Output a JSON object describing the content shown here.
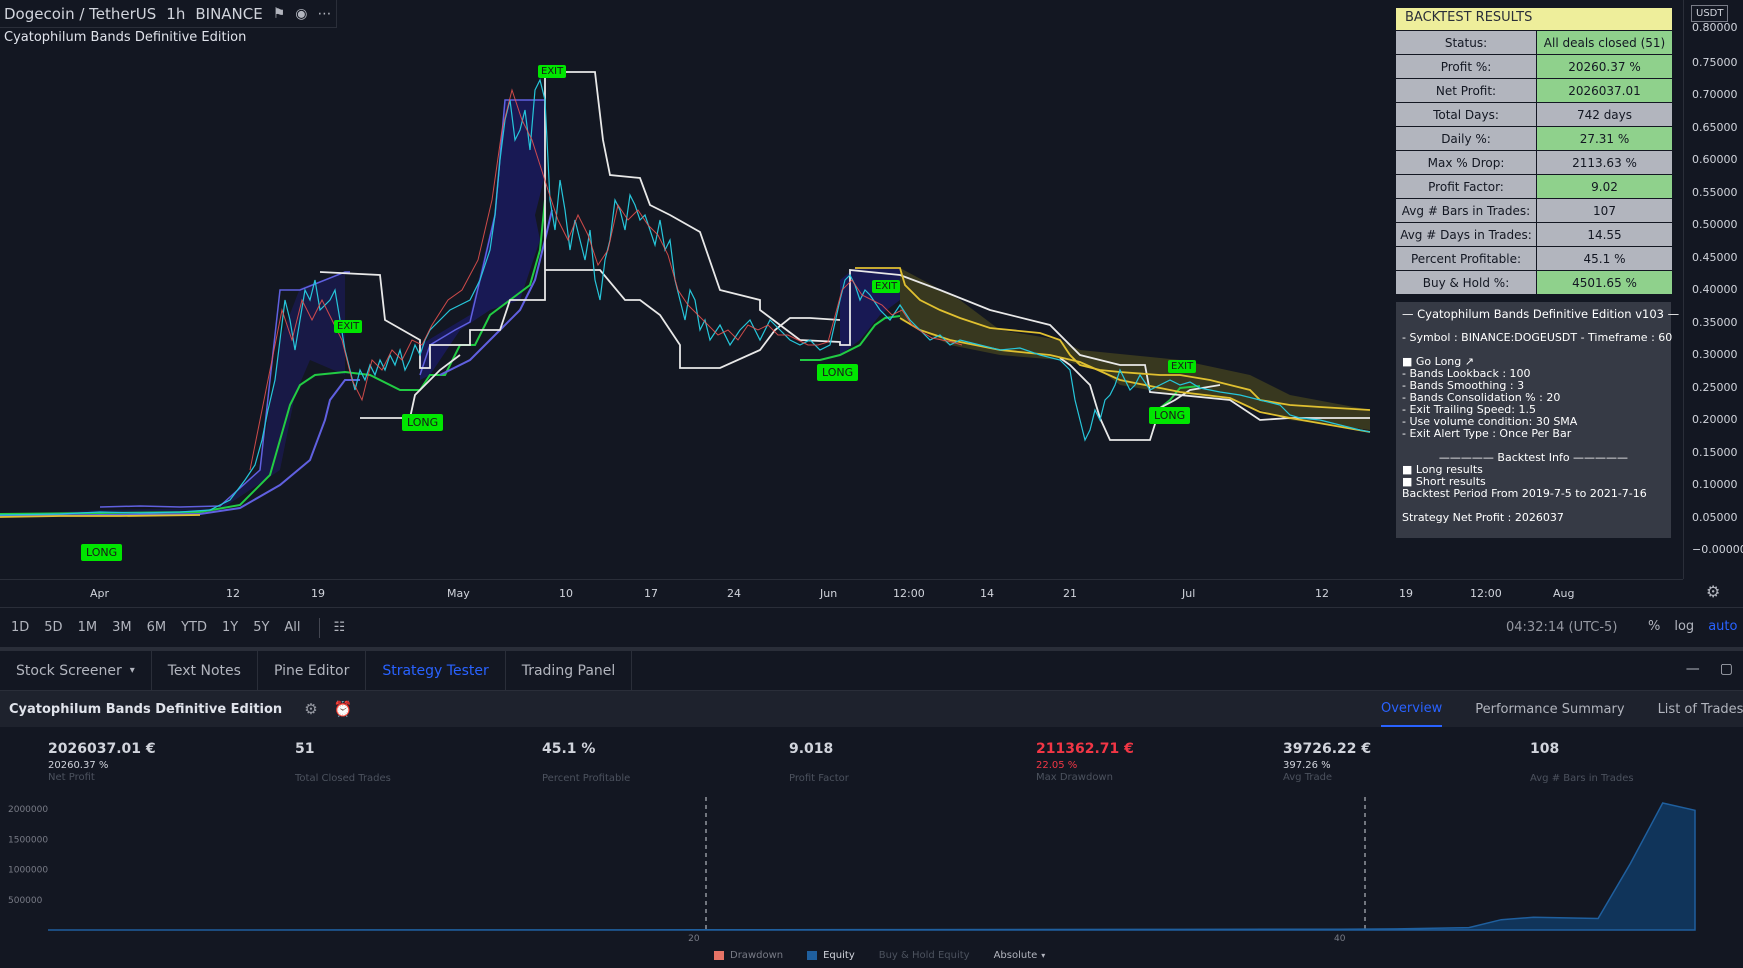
{
  "symbol_bar": {
    "symbol": "Dogecoin / TetherUS",
    "interval": "1h",
    "exchange": "BINANCE",
    "icons": [
      "flag-icon",
      "eye-icon",
      "more-icon"
    ]
  },
  "indicator_title": "Cyatophilum Bands Definitive Edition",
  "price_axis": {
    "currency": "USDT",
    "ticks": [
      "0.80000",
      "0.75000",
      "0.70000",
      "0.65000",
      "0.60000",
      "0.55000",
      "0.50000",
      "0.45000",
      "0.40000",
      "0.35000",
      "0.30000",
      "0.25000",
      "0.20000",
      "0.15000",
      "0.10000",
      "0.05000",
      "−0.00000"
    ]
  },
  "time_axis": {
    "ticks": [
      "Apr",
      "12",
      "19",
      "May",
      "10",
      "17",
      "24",
      "Jun",
      "12:00",
      "14",
      "21",
      "Jul",
      "12",
      "19",
      "12:00",
      "Aug"
    ]
  },
  "signals": {
    "long": "LONG",
    "exit": "EXIT"
  },
  "backtest_results": {
    "title": "BACKTEST RESULTS",
    "rows": [
      {
        "key": "Status:",
        "value": "All deals closed (51)",
        "highlight": "green"
      },
      {
        "key": "Profit %:",
        "value": "20260.37 %",
        "highlight": "green"
      },
      {
        "key": "Net Profit:",
        "value": "2026037.01",
        "highlight": "green"
      },
      {
        "key": "Total Days:",
        "value": "742 days",
        "highlight": "grey"
      },
      {
        "key": "Daily %:",
        "value": "27.31 %",
        "highlight": "green"
      },
      {
        "key": "Max % Drop:",
        "value": "2113.63 %",
        "highlight": "grey"
      },
      {
        "key": "Profit Factor:",
        "value": "9.02",
        "highlight": "green"
      },
      {
        "key": "Avg # Bars in Trades:",
        "value": "107",
        "highlight": "grey"
      },
      {
        "key": "Avg # Days in Trades:",
        "value": "14.55",
        "highlight": "grey"
      },
      {
        "key": "Percent Profitable:",
        "value": "45.1 %",
        "highlight": "grey"
      },
      {
        "key": "Buy & Hold %:",
        "value": "4501.65 %",
        "highlight": "green"
      }
    ]
  },
  "info_box": {
    "title": "— Cyatophilum Bands Definitive Edition v103 —",
    "symbol_line": "- Symbol : BINANCE:DOGEUSDT - Timeframe : 60",
    "settings": [
      "■ Go Long ↗",
      "- Bands Lookback : 100",
      "- Bands Smoothing : 3",
      "- Bands Consolidation % : 20",
      "- Exit Trailing Speed: 1.5",
      "- Use volume condition: 30 SMA",
      "- Exit Alert Type : Once Per Bar"
    ],
    "backtest_header": "————— Backtest Info —————",
    "backtest_lines": [
      "■ Long results",
      "■ Short results",
      "Backtest Period From 2019-7-5 to 2021-7-16"
    ],
    "net_profit_line": "Strategy Net Profit : 2026037"
  },
  "range_bar": {
    "ranges": [
      "1D",
      "5D",
      "1M",
      "3M",
      "6M",
      "YTD",
      "1Y",
      "5Y",
      "All"
    ],
    "clock": "04:32:14 (UTC-5)",
    "percent": "%",
    "log": "log",
    "auto": "auto"
  },
  "bottom_tabs": {
    "tabs": [
      "Stock Screener",
      "Text Notes",
      "Pine Editor",
      "Strategy Tester",
      "Trading Panel"
    ],
    "active": "Strategy Tester"
  },
  "strategy": {
    "name": "Cyatophilum Bands Definitive Edition",
    "sub_tabs": [
      "Overview",
      "Performance Summary",
      "List of Trades"
    ],
    "active_sub_tab": "Overview",
    "metrics": [
      {
        "value": "2026037.01 €",
        "sub": "20260.37 %",
        "label": "Net Profit"
      },
      {
        "value": "51",
        "sub": "",
        "label": "Total Closed Trades"
      },
      {
        "value": "45.1 %",
        "sub": "",
        "label": "Percent Profitable"
      },
      {
        "value": "9.018",
        "sub": "",
        "label": "Profit Factor"
      },
      {
        "value": "211362.71 €",
        "sub": "22.05 %",
        "label": "Max Drawdown",
        "negative": true
      },
      {
        "value": "39726.22 €",
        "sub": "397.26 %",
        "label": "Avg Trade"
      },
      {
        "value": "108",
        "sub": "",
        "label": "Avg # Bars in Trades"
      }
    ]
  },
  "equity_chart": {
    "y_ticks": [
      "2000000",
      "1500000",
      "1000000",
      "500000"
    ],
    "x_ticks": [
      "20",
      "40"
    ],
    "legend": [
      "Drawdown",
      "Equity",
      "Buy & Hold Equity",
      "Absolute"
    ],
    "colors": {
      "drawdown": "#e57366",
      "equity": "#1f5f9e",
      "equity_fill": "#10345a"
    }
  },
  "chart_data": {
    "type": "area",
    "title": "",
    "xlabel": "",
    "ylabel": "",
    "ylim": [
      0,
      2200000
    ],
    "xlim": [
      0,
      51
    ],
    "x": [
      0,
      5,
      10,
      15,
      20,
      25,
      30,
      35,
      38,
      40,
      42,
      44,
      45,
      46,
      47,
      48,
      49,
      50,
      51
    ],
    "series": [
      {
        "values": [
          0,
          500,
          1000,
          2000,
          4000,
          6000,
          8000,
          10000,
          12000,
          14000,
          20000,
          40000,
          170000,
          210000,
          200000,
          190000,
          1100000,
          2100000,
          1980000
        ]
      }
    ]
  }
}
